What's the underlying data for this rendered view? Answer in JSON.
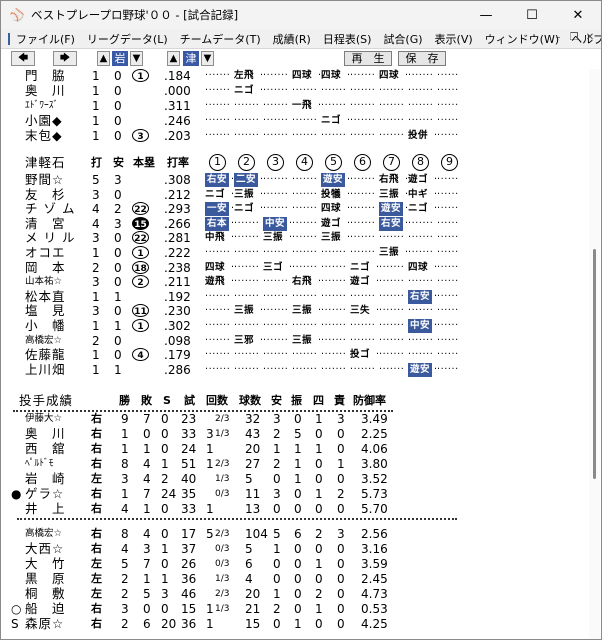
{
  "window": {
    "title": "ベストプレープロ野球'００ - [試合記録]"
  },
  "menu": [
    "ファイル(F)",
    "リーグデータ(L)",
    "チームデータ(T)",
    "成績(R)",
    "日程表(S)",
    "試合(G)",
    "表示(V)",
    "ウィンドウ(W)",
    "ヘルプ(H)"
  ],
  "toolbar": {
    "team1": "岩",
    "team2": "津",
    "replay": "再　生",
    "save": "保　存"
  },
  "top_batters": [
    {
      "name": "門　脇",
      "ab": "1",
      "h": "0",
      "hr": "1",
      "avg": ".184",
      "results": [
        "",
        "左飛",
        "",
        "四球",
        "四球",
        "",
        "四球",
        "",
        ""
      ]
    },
    {
      "name": "奥　川",
      "ab": "1",
      "h": "0",
      "hr": "",
      "avg": ".000",
      "results": [
        "",
        "ニゴ",
        "",
        "",
        "",
        "",
        "",
        "",
        ""
      ]
    },
    {
      "name": "ｴﾄﾞﾜｰｽﾞ",
      "ab": "1",
      "h": "0",
      "hr": "",
      "avg": ".311",
      "results": [
        "",
        "",
        "",
        "一飛",
        "",
        "",
        "",
        "",
        ""
      ]
    },
    {
      "name": "小園◆",
      "ab": "1",
      "h": "0",
      "hr": "",
      "avg": ".246",
      "results": [
        "",
        "",
        "",
        "",
        "ニゴ",
        "",
        "",
        "",
        ""
      ]
    },
    {
      "name": "末包◆",
      "ab": "1",
      "h": "0",
      "hr": "3",
      "avg": ".203",
      "results": [
        "",
        "",
        "",
        "",
        "",
        "",
        "",
        "投併",
        ""
      ]
    }
  ],
  "batting_header": {
    "team": "津軽石",
    "ab": "打",
    "h": "安",
    "rbi": "本塁",
    "avg": "打率",
    "innings": [
      "1",
      "2",
      "3",
      "4",
      "5",
      "6",
      "7",
      "8",
      "9"
    ]
  },
  "batters": [
    {
      "name": "野間☆",
      "ab": "5",
      "h": "3",
      "hr": "",
      "hrfill": false,
      "avg": ".308",
      "results": [
        "右安|h",
        "二安|h",
        "",
        "",
        "遊安|h",
        "",
        "右飛",
        "遊ゴ",
        ""
      ]
    },
    {
      "name": "友　杉",
      "ab": "3",
      "h": "0",
      "hr": "",
      "hrfill": false,
      "avg": ".212",
      "results": [
        "ニゴ",
        "三振",
        "",
        "",
        "投犠",
        "",
        "三振",
        "中ギ",
        ""
      ]
    },
    {
      "name": "チ ゾ ム",
      "ab": "4",
      "h": "2",
      "hr": "22",
      "hrfill": false,
      "avg": ".293",
      "results": [
        "一安|h",
        "ニゴ",
        "",
        "",
        "四球",
        "",
        "遊安|h",
        "ニゴ",
        ""
      ]
    },
    {
      "name": "清　宮",
      "ab": "4",
      "h": "3",
      "hr": "15",
      "hrfill": true,
      "avg": ".266",
      "results": [
        "右本|h",
        "",
        "中安|h",
        "",
        "遊ゴ",
        "",
        "右安|h",
        "",
        ""
      ]
    },
    {
      "name": "メ リ ル",
      "ab": "3",
      "h": "0",
      "hr": "22",
      "hrfill": false,
      "avg": ".281",
      "results": [
        "中飛",
        "",
        "三振",
        "",
        "三振",
        "",
        "",
        "",
        ""
      ]
    },
    {
      "name": "オコエ",
      "ab": "1",
      "h": "0",
      "hr": "1",
      "hrfill": false,
      "avg": ".222",
      "results": [
        "",
        "",
        "",
        "",
        "",
        "",
        "三振",
        "",
        ""
      ]
    },
    {
      "name": "岡　本",
      "ab": "2",
      "h": "0",
      "hr": "18",
      "hrfill": false,
      "avg": ".238",
      "results": [
        "四球",
        "",
        "三ゴ",
        "",
        "",
        "ニゴ",
        "",
        "四球",
        ""
      ]
    },
    {
      "name": "山本祐☆",
      "ab": "3",
      "h": "0",
      "hr": "2",
      "hrfill": false,
      "avg": ".211",
      "results": [
        "遊飛",
        "",
        "",
        "右飛",
        "",
        "遊ゴ",
        "",
        "",
        ""
      ]
    },
    {
      "name": "松本直",
      "ab": "1",
      "h": "1",
      "hr": "",
      "hrfill": false,
      "avg": ".192",
      "results": [
        "",
        "",
        "",
        "",
        "",
        "",
        "",
        "右安|h",
        ""
      ]
    },
    {
      "name": "塩　見",
      "ab": "3",
      "h": "0",
      "hr": "11",
      "hrfill": false,
      "avg": ".230",
      "results": [
        "",
        "三振",
        "",
        "三振",
        "",
        "三失",
        "",
        "",
        ""
      ]
    },
    {
      "name": "小　幡",
      "ab": "1",
      "h": "1",
      "hr": "1",
      "hrfill": false,
      "avg": ".302",
      "results": [
        "",
        "",
        "",
        "",
        "",
        "",
        "",
        "中安|h",
        ""
      ]
    },
    {
      "name": "高橋宏☆",
      "ab": "2",
      "h": "0",
      "hr": "",
      "hrfill": false,
      "avg": ".098",
      "results": [
        "",
        "三邪",
        "",
        "三振",
        "",
        "",
        "",
        "",
        ""
      ]
    },
    {
      "name": "佐藤龍",
      "ab": "1",
      "h": "0",
      "hr": "4",
      "hrfill": false,
      "avg": ".179",
      "results": [
        "",
        "",
        "",
        "",
        "",
        "投ゴ",
        "",
        "",
        ""
      ]
    },
    {
      "name": "上川畑",
      "ab": "1",
      "h": "1",
      "hr": "",
      "hrfill": false,
      "avg": ".286",
      "results": [
        "",
        "",
        "",
        "",
        "",
        "",
        "",
        "遊安|h",
        ""
      ]
    }
  ],
  "pitching_header": {
    "title": "投手成績",
    "w": "勝",
    "l": "敗",
    "s": "S",
    "g": "試",
    "ip": "回数",
    "bf": "球数",
    "h": "安",
    "k": "振",
    "bb": "四",
    "er": "責",
    "era": "防御率"
  },
  "pitchers_a": [
    {
      "mark": "",
      "name": "伊藤大☆",
      "hand": "右",
      "w": "9",
      "l": "7",
      "s": "0",
      "g": "23",
      "ip": "2/3",
      "ipw": "",
      "bf": "32",
      "h": "3",
      "k": "0",
      "bb": "1",
      "er": "3",
      "era": "3.49"
    },
    {
      "mark": "",
      "name": "奥　川",
      "hand": "右",
      "w": "1",
      "l": "0",
      "s": "0",
      "g": "33",
      "ip": "1/3",
      "ipw": "3",
      "bf": "43",
      "h": "2",
      "k": "5",
      "bb": "0",
      "er": "0",
      "era": "2.25"
    },
    {
      "mark": "",
      "name": "西　舘",
      "hand": "右",
      "w": "1",
      "l": "1",
      "s": "0",
      "g": "24",
      "ip": "",
      "ipw": "1",
      "bf": "20",
      "h": "1",
      "k": "1",
      "bb": "1",
      "er": "0",
      "era": "4.06"
    },
    {
      "mark": "",
      "name": "ﾍﾟﾙﾄﾞﾓ",
      "hand": "右",
      "w": "8",
      "l": "4",
      "s": "1",
      "g": "51",
      "ip": "2/3",
      "ipw": "1",
      "bf": "27",
      "h": "2",
      "k": "1",
      "bb": "0",
      "er": "1",
      "era": "3.80"
    },
    {
      "mark": "",
      "name": "岩　崎",
      "hand": "左",
      "w": "3",
      "l": "4",
      "s": "2",
      "g": "40",
      "ip": "1/3",
      "ipw": "",
      "bf": "5",
      "h": "0",
      "k": "1",
      "bb": "0",
      "er": "0",
      "era": "3.52"
    },
    {
      "mark": "●",
      "name": "ゲラ☆",
      "hand": "右",
      "w": "1",
      "l": "7",
      "s": "24",
      "g": "35",
      "ip": "0/3",
      "ipw": "",
      "bf": "11",
      "h": "3",
      "k": "0",
      "bb": "1",
      "er": "2",
      "era": "5.73"
    },
    {
      "mark": "",
      "name": "井　上",
      "hand": "右",
      "w": "4",
      "l": "1",
      "s": "0",
      "g": "33",
      "ip": "",
      "ipw": "1",
      "bf": "13",
      "h": "0",
      "k": "0",
      "bb": "0",
      "er": "0",
      "era": "5.70"
    }
  ],
  "pitchers_b": [
    {
      "mark": "",
      "name": "高橋宏☆",
      "hand": "右",
      "w": "8",
      "l": "4",
      "s": "0",
      "g": "17",
      "ip": "2/3",
      "ipw": "5",
      "bf": "104",
      "h": "5",
      "k": "6",
      "bb": "2",
      "er": "3",
      "era": "2.56"
    },
    {
      "mark": "",
      "name": "大西☆",
      "hand": "右",
      "w": "4",
      "l": "3",
      "s": "1",
      "g": "37",
      "ip": "0/3",
      "ipw": "",
      "bf": "5",
      "h": "1",
      "k": "0",
      "bb": "0",
      "er": "0",
      "era": "3.16"
    },
    {
      "mark": "",
      "name": "大　竹",
      "hand": "左",
      "w": "5",
      "l": "7",
      "s": "0",
      "g": "26",
      "ip": "0/3",
      "ipw": "",
      "bf": "6",
      "h": "0",
      "k": "0",
      "bb": "1",
      "er": "0",
      "era": "3.59"
    },
    {
      "mark": "",
      "name": "黒　原",
      "hand": "左",
      "w": "2",
      "l": "1",
      "s": "1",
      "g": "36",
      "ip": "1/3",
      "ipw": "",
      "bf": "4",
      "h": "0",
      "k": "0",
      "bb": "0",
      "er": "0",
      "era": "2.45"
    },
    {
      "mark": "",
      "name": "桐　敷",
      "hand": "左",
      "w": "2",
      "l": "5",
      "s": "3",
      "g": "46",
      "ip": "2/3",
      "ipw": "",
      "bf": "20",
      "h": "1",
      "k": "0",
      "bb": "2",
      "er": "0",
      "era": "4.73"
    },
    {
      "mark": "○",
      "name": "船　迫",
      "hand": "右",
      "w": "3",
      "l": "0",
      "s": "0",
      "g": "15",
      "ip": "1/3",
      "ipw": "1",
      "bf": "21",
      "h": "2",
      "k": "0",
      "bb": "1",
      "er": "0",
      "era": "0.53"
    },
    {
      "mark": "S",
      "name": "森原☆",
      "hand": "右",
      "w": "2",
      "l": "6",
      "s": "20",
      "g": "36",
      "ip": "",
      "ipw": "1",
      "bf": "15",
      "h": "0",
      "k": "1",
      "bb": "0",
      "er": "0",
      "era": "4.25"
    }
  ],
  "colors": {
    "highlight": "#3b5a9e",
    "titlebar": "#f3f3f3"
  }
}
